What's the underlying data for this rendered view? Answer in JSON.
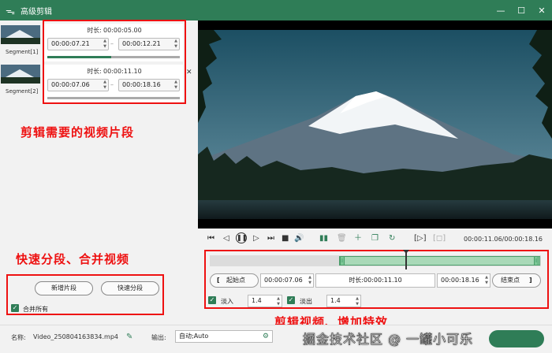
{
  "window": {
    "title": "高级剪辑",
    "app_icon": "rabbit-icon",
    "controls": [
      "minimize-icon",
      "maximize-icon",
      "close-icon"
    ]
  },
  "segments": [
    {
      "label": "Segment[1]",
      "duration_label": "时长:",
      "duration": "00:00:05.00",
      "start": "00:00:07.21",
      "end": "00:00:12.21",
      "progress": 0.48
    },
    {
      "label": "Segment[2]",
      "duration_label": "时长:",
      "duration": "00:00:11.10",
      "start": "00:00:07.06",
      "end": "00:00:18.16",
      "progress": 0
    }
  ],
  "segment_close": "✕",
  "annotations": {
    "segments": "剪辑需要的视频片段",
    "split_merge": "快速分段、合并视频",
    "effects": "剪辑视频、增加特效"
  },
  "split_panel": {
    "new_segment": "新增片段",
    "quick_split": "快速分段",
    "merge_all": "合并所有"
  },
  "player": {
    "timecode": "00:00:11.06/00:00:18.16",
    "icons": [
      "skip-start-icon",
      "step-back-icon",
      "pause-icon",
      "step-forward-icon",
      "skip-end-icon",
      "stop-icon",
      "volume-icon",
      "split-icon",
      "delete-icon",
      "add-icon",
      "copy-icon",
      "rotate-icon",
      "crop-icon",
      "snapshot-icon"
    ]
  },
  "timeline": {
    "selection_start": 0.39,
    "selection_end": 1.0,
    "playhead": 0.59
  },
  "range": {
    "start_point": "起始点",
    "start_time": "00:00:07.06",
    "duration_label": "时长:",
    "duration": "00:00:11.10",
    "end_time": "00:00:18.16",
    "end_point": "结束点"
  },
  "fade": {
    "fade_in_label": "淡入",
    "fade_in_value": "1.4",
    "fade_out_label": "淡出",
    "fade_out_value": "1.4"
  },
  "bottom": {
    "name_label": "名称:",
    "name_value": "Video_250804163834.mp4",
    "output_label": "输出:",
    "output_value": "自动;Auto",
    "watermark": "掘金技术社区 @ 一罐小可乐"
  },
  "colors": {
    "accent": "#2f7d57",
    "annotation": "#ee1111"
  }
}
